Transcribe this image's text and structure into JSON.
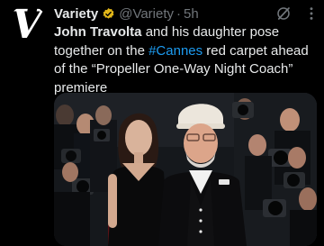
{
  "avatar": {
    "glyph": "V"
  },
  "header": {
    "name": "Variety",
    "handle": "@Variety",
    "separator": "·",
    "time": "5h"
  },
  "tweet": {
    "bold_lead": "John Travolta",
    "text_before_hashtag": " and his daughter pose together on the ",
    "hashtag": "#Cannes",
    "text_after_hashtag": " red carpet ahead of the “Propeller One-Way Night Coach” premiere"
  },
  "colors": {
    "background": "#000000",
    "text": "#e7e9ea",
    "muted": "#71767b",
    "link": "#1d9bf0",
    "verified_badge": "#e2b719"
  },
  "icons": [
    "verified-badge-icon",
    "grok-icon",
    "more-icon"
  ]
}
